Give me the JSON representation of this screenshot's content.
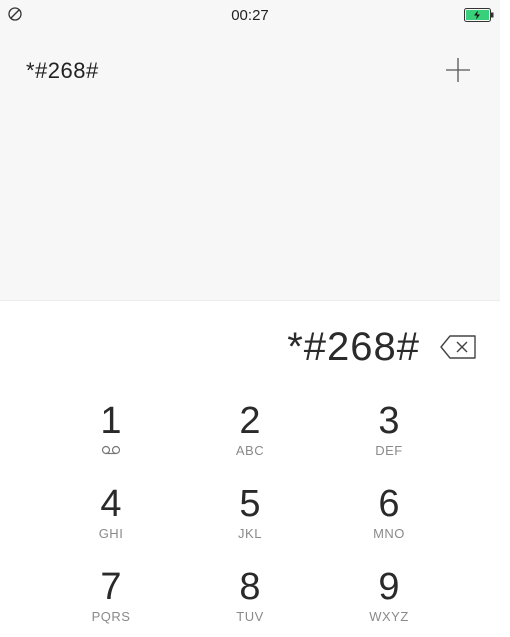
{
  "status_bar": {
    "time": "00:27",
    "icons": [
      "do-not-disturb-icon",
      "battery-charging-icon"
    ],
    "battery_color": "#38d07a"
  },
  "header": {
    "number": "*#268#",
    "add_icon": "plus-icon"
  },
  "dialpad": {
    "display": "*#268#",
    "backspace_icon": "backspace-icon",
    "keys": [
      {
        "num": "1",
        "letters": ""
      },
      {
        "num": "2",
        "letters": "ABC"
      },
      {
        "num": "3",
        "letters": "DEF"
      },
      {
        "num": "4",
        "letters": "GHI"
      },
      {
        "num": "5",
        "letters": "JKL"
      },
      {
        "num": "6",
        "letters": "MNO"
      },
      {
        "num": "7",
        "letters": "PQRS"
      },
      {
        "num": "8",
        "letters": "TUV"
      },
      {
        "num": "9",
        "letters": "WXYZ"
      }
    ]
  }
}
